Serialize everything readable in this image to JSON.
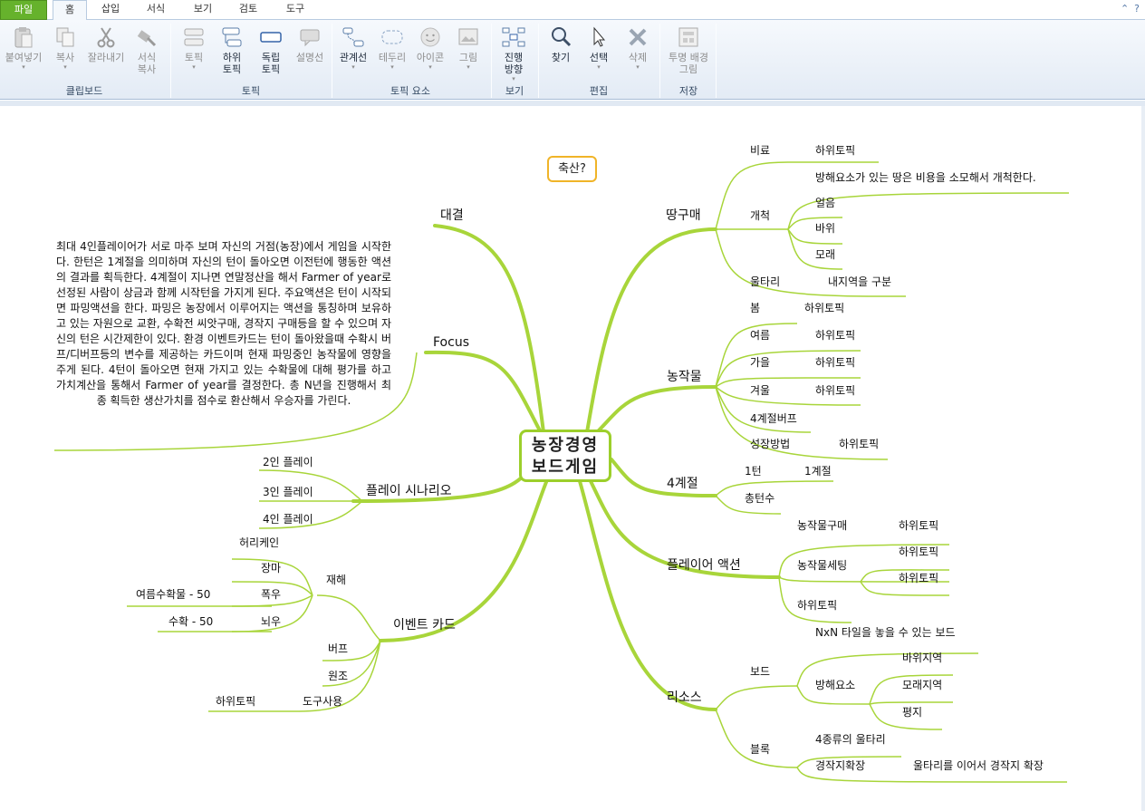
{
  "tabs": {
    "file": "파일",
    "home": "홈",
    "insert": "삽입",
    "format": "서식",
    "view": "보기",
    "review": "검토",
    "tools": "도구"
  },
  "ribbon": {
    "paste": "붙여넣기",
    "copy": "복사",
    "cut": "잘라내기",
    "format_copy": "서식\n복사",
    "clipboard_group": "클립보드",
    "topic": "토픽",
    "subtopic": "하위\n토픽",
    "free_topic": "독립\n토픽",
    "callout": "설명선",
    "topic_group": "토픽",
    "relation": "관계선",
    "boundary": "테두리",
    "icon": "아이콘",
    "image": "그림",
    "topic_elements_group": "토픽 요소",
    "direction": "진행\n방향",
    "view_group": "보기",
    "find": "찾기",
    "select": "선택",
    "delete": "삭제",
    "edit_group": "편집",
    "transparent_bg": "투명 배경\n그림",
    "save_group": "저장"
  },
  "map": {
    "central": "농장경영\n보드게임",
    "floating": "축산?",
    "left": {
      "daegyeol": "대결",
      "focus": "Focus",
      "focus_note": "최대 4인플레이어가 서로 마주 보며 자신의 거점(농장)에서 게임을 시작한다. 한턴은 1계절을 의미하며 자신의 턴이 돌아오면 이전턴에 행동한 액션의 결과를 획득한다. 4계절이 지나면 연말정산을 해서 Farmer of year로 선정된 사람이 상금과 함께 시작턴을 가지게 된다. 주요액션은 턴이 시작되면 파밍액션을 한다. 파밍은 농장에서 이루어지는 액션을 통칭하며 보유하고 있는 자원으로 교환, 수확전 씨앗구매, 경작지 구매등을 할 수 있으며 자신의 턴은 시간제한이 있다. 환경 이벤트카드는 턴이 돌아왔을때 수확시 버프/디버프등의 변수를 제공하는 카드이며 현재 파밍중인 농작물에 영향을 주게 된다. 4턴이 돌아오면 현재 가지고 있는 수확물에 대해 평가를 하고 가치계산을 통해서 Farmer of year를 결정한다. 총 N년을 진행해서 최종 획득한 생산가치를 점수로 환산해서 우승자를 가린다.",
      "scenario": "플레이 시나리오",
      "scenario_items": [
        "2인 플레이",
        "3인 플레이",
        "4인 플레이"
      ],
      "event": "이벤트 카드",
      "disaster": "재해",
      "disaster_items": [
        "허리케인",
        "장마",
        "폭우",
        "뇌우"
      ],
      "heavy_rain_note": "여름수확물 - 50",
      "storm_note": "수확 - 50",
      "buff": "버프",
      "support": "원조",
      "tool_use": "도구사용",
      "tool_sub": "하위토픽"
    },
    "right": {
      "land": "땅구매",
      "fertilizer": "비료",
      "fertilizer_sub": "하위토픽",
      "cultivate": "개척",
      "cultivate_note": "방해요소가 있는 땅은 비용을 소모해서 개척한다.",
      "cultivate_items": [
        "얼음",
        "바위",
        "모래"
      ],
      "fence": "울타리",
      "fence_sub": "내지역을 구분",
      "crops": "농작물",
      "seasons": [
        "봄",
        "여름",
        "가을",
        "겨울"
      ],
      "season_sub": "하위토픽",
      "season_buff": "4계절버프",
      "growth": "성장방법",
      "growth_sub": "하위토픽",
      "four_seasons": "4계절",
      "one_turn": "1턴",
      "one_season": "1계절",
      "total_turns": "총턴수",
      "actions": "플레이어 액션",
      "crop_buy": "농작물구매",
      "crop_buy_sub": "하위토픽",
      "crop_set": "농작물세팅",
      "crop_set_subs": [
        "하위토픽",
        "하위토픽"
      ],
      "action_sub": "하위토픽",
      "resources": "리소스",
      "board": "보드",
      "board_note": "NxN 타일을 놓을 수 있는 보드",
      "obstacle": "방해요소",
      "obstacle_items": [
        "바위지역",
        "모래지역",
        "평지"
      ],
      "block": "블록",
      "fence4": "4종류의 울타리",
      "expand": "경작지확장",
      "expand_note": "울타리를 이어서 경작지 확장"
    }
  }
}
